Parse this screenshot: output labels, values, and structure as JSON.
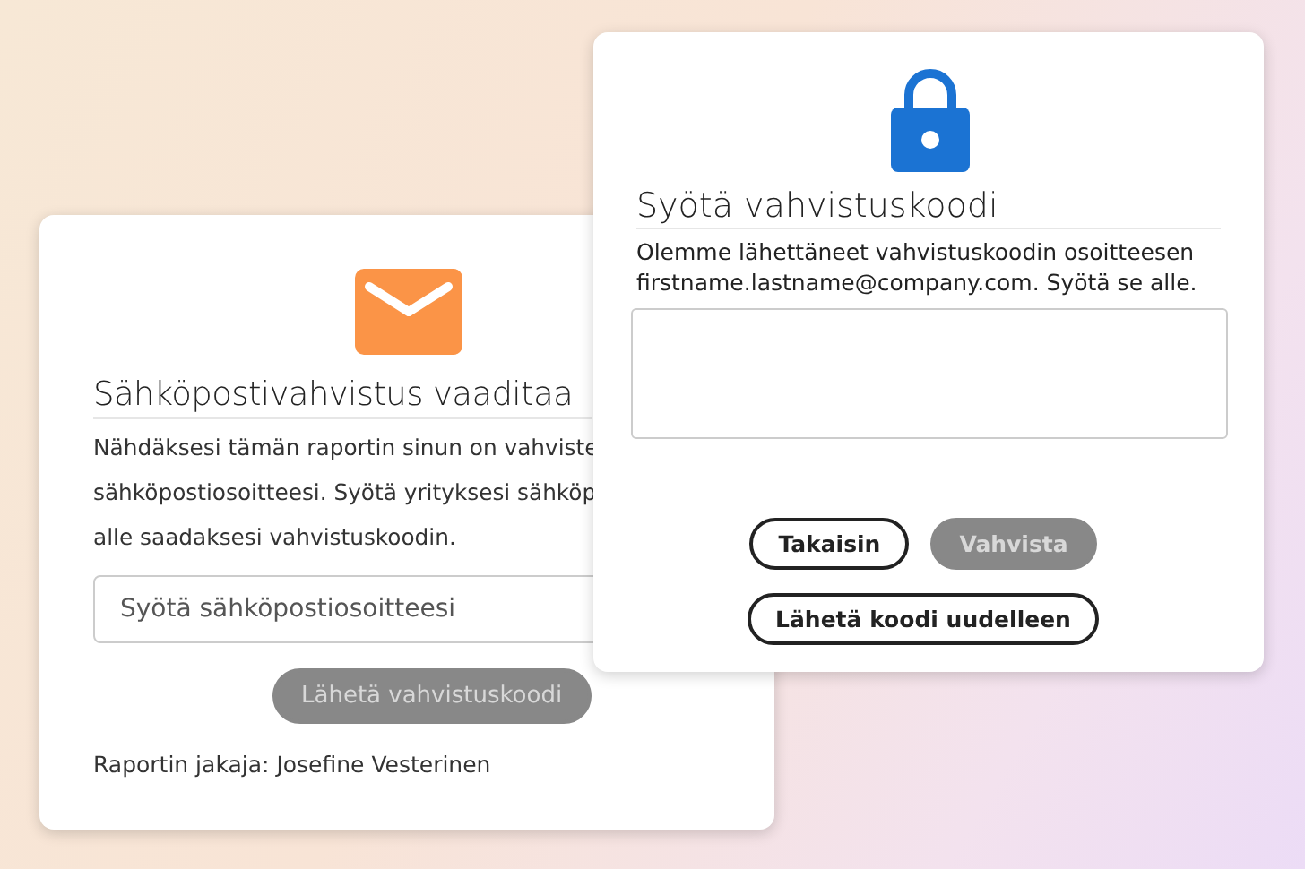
{
  "email_dialog": {
    "title": "Sähköpostivahvistus vaaditaa",
    "description_lines": [
      "Nähdäksesi tämän raportin sinun on vahviste",
      "sähköpostiosoitteesi. Syötä yrityksesi sähköp",
      "alle saadaksesi vahvistuskoodin."
    ],
    "email_field": {
      "placeholder": "Syötä sähköpostiosoitteesi"
    },
    "send_button": {
      "label": "Lähetä vahvistuskoodi",
      "disabled": true
    },
    "shared_by": "Raportin jakaja: Josefine Vesterinen"
  },
  "code_dialog": {
    "title": "Syötä vahvistuskoodi",
    "description": "Olemme lähettäneet vahvistuskoodin osoitteesen firstname.lastname@company.com. Syötä se alle.",
    "buttons": [
      {
        "label": "Takaisin",
        "disabled": false
      },
      {
        "label": "Vahvista",
        "disabled": true
      }
    ],
    "resend_button": {
      "label": "Lähetä koodi uudelleen",
      "disabled": false
    }
  }
}
